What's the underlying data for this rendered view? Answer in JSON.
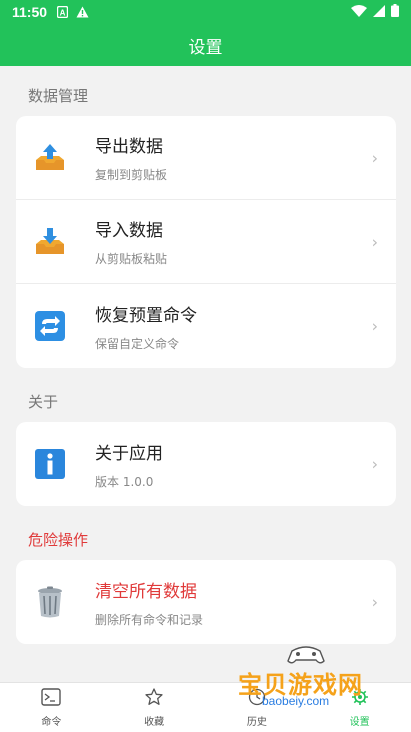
{
  "status_bar": {
    "time": "11:50"
  },
  "app_bar": {
    "title": "设置"
  },
  "sections": {
    "data_management": {
      "title": "数据管理",
      "items": [
        {
          "title": "导出数据",
          "subtitle": "复制到剪贴板",
          "icon": "export-tray-icon"
        },
        {
          "title": "导入数据",
          "subtitle": "从剪贴板粘贴",
          "icon": "import-tray-icon"
        },
        {
          "title": "恢复预置命令",
          "subtitle": "保留自定义命令",
          "icon": "restore-arrows-icon"
        }
      ]
    },
    "about": {
      "title": "关于",
      "items": [
        {
          "title": "关于应用",
          "subtitle": "版本 1.0.0",
          "icon": "info-icon"
        }
      ]
    },
    "danger": {
      "title": "危险操作",
      "items": [
        {
          "title": "清空所有数据",
          "subtitle": "删除所有命令和记录",
          "icon": "trash-can-icon"
        }
      ]
    }
  },
  "bottom_nav": {
    "items": [
      {
        "label": "命令",
        "icon": "terminal-icon"
      },
      {
        "label": "收藏",
        "icon": "star-icon"
      },
      {
        "label": "历史",
        "icon": "clock-icon"
      },
      {
        "label": "设置",
        "icon": "gear-icon",
        "active": true
      }
    ]
  },
  "watermark": {
    "text": "宝贝游戏网",
    "url": "baobeiy.com"
  },
  "colors": {
    "accent": "#22c25a",
    "danger": "#e03a3a",
    "chevron": "#bbbbbb"
  }
}
